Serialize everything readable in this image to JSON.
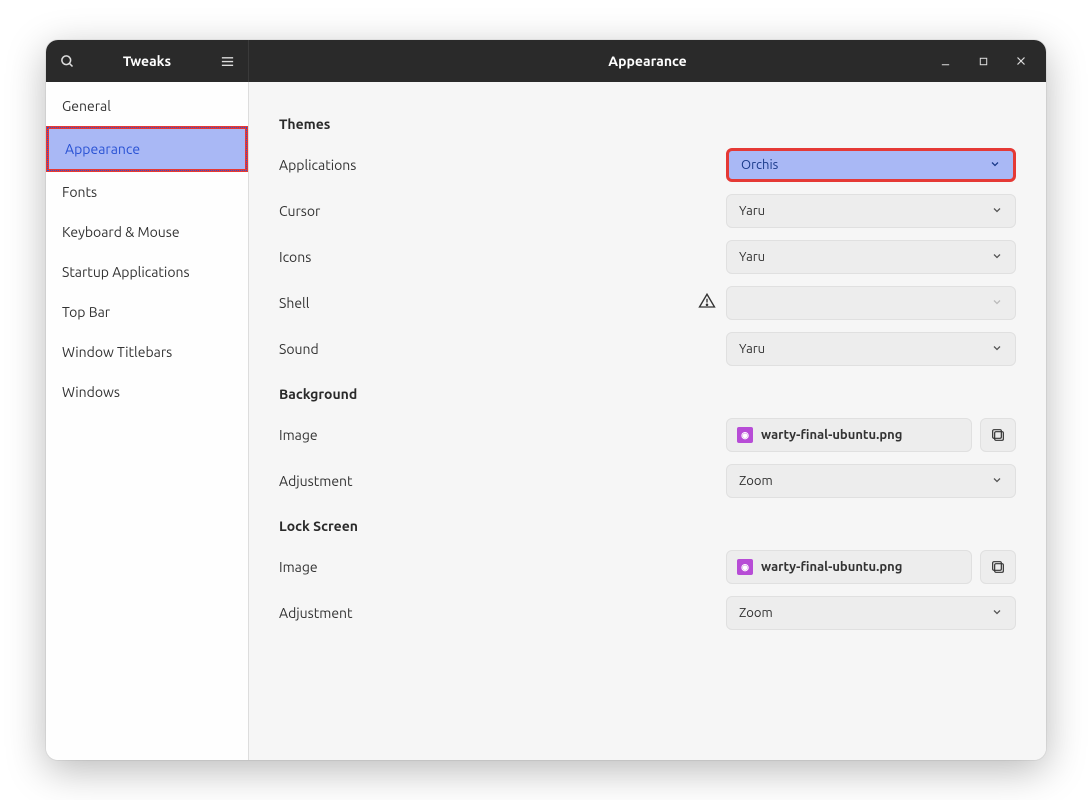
{
  "header": {
    "sidebar_title": "Tweaks",
    "page_title": "Appearance"
  },
  "sidebar": {
    "items": [
      {
        "label": "General",
        "selected": false
      },
      {
        "label": "Appearance",
        "selected": true,
        "highlight": true
      },
      {
        "label": "Fonts",
        "selected": false
      },
      {
        "label": "Keyboard & Mouse",
        "selected": false
      },
      {
        "label": "Startup Applications",
        "selected": false
      },
      {
        "label": "Top Bar",
        "selected": false
      },
      {
        "label": "Window Titlebars",
        "selected": false
      },
      {
        "label": "Windows",
        "selected": false
      }
    ]
  },
  "content": {
    "themes_header": "Themes",
    "themes": {
      "applications": {
        "label": "Applications",
        "value": "Orchis",
        "highlight": true
      },
      "cursor": {
        "label": "Cursor",
        "value": "Yaru"
      },
      "icons": {
        "label": "Icons",
        "value": "Yaru"
      },
      "shell": {
        "label": "Shell",
        "value": "",
        "disabled": true,
        "warning": true
      },
      "sound": {
        "label": "Sound",
        "value": "Yaru"
      }
    },
    "background_header": "Background",
    "background": {
      "image": {
        "label": "Image",
        "value": "warty-final-ubuntu.png"
      },
      "adjustment": {
        "label": "Adjustment",
        "value": "Zoom"
      }
    },
    "lockscreen_header": "Lock Screen",
    "lockscreen": {
      "image": {
        "label": "Image",
        "value": "warty-final-ubuntu.png"
      },
      "adjustment": {
        "label": "Adjustment",
        "value": "Zoom"
      }
    }
  }
}
